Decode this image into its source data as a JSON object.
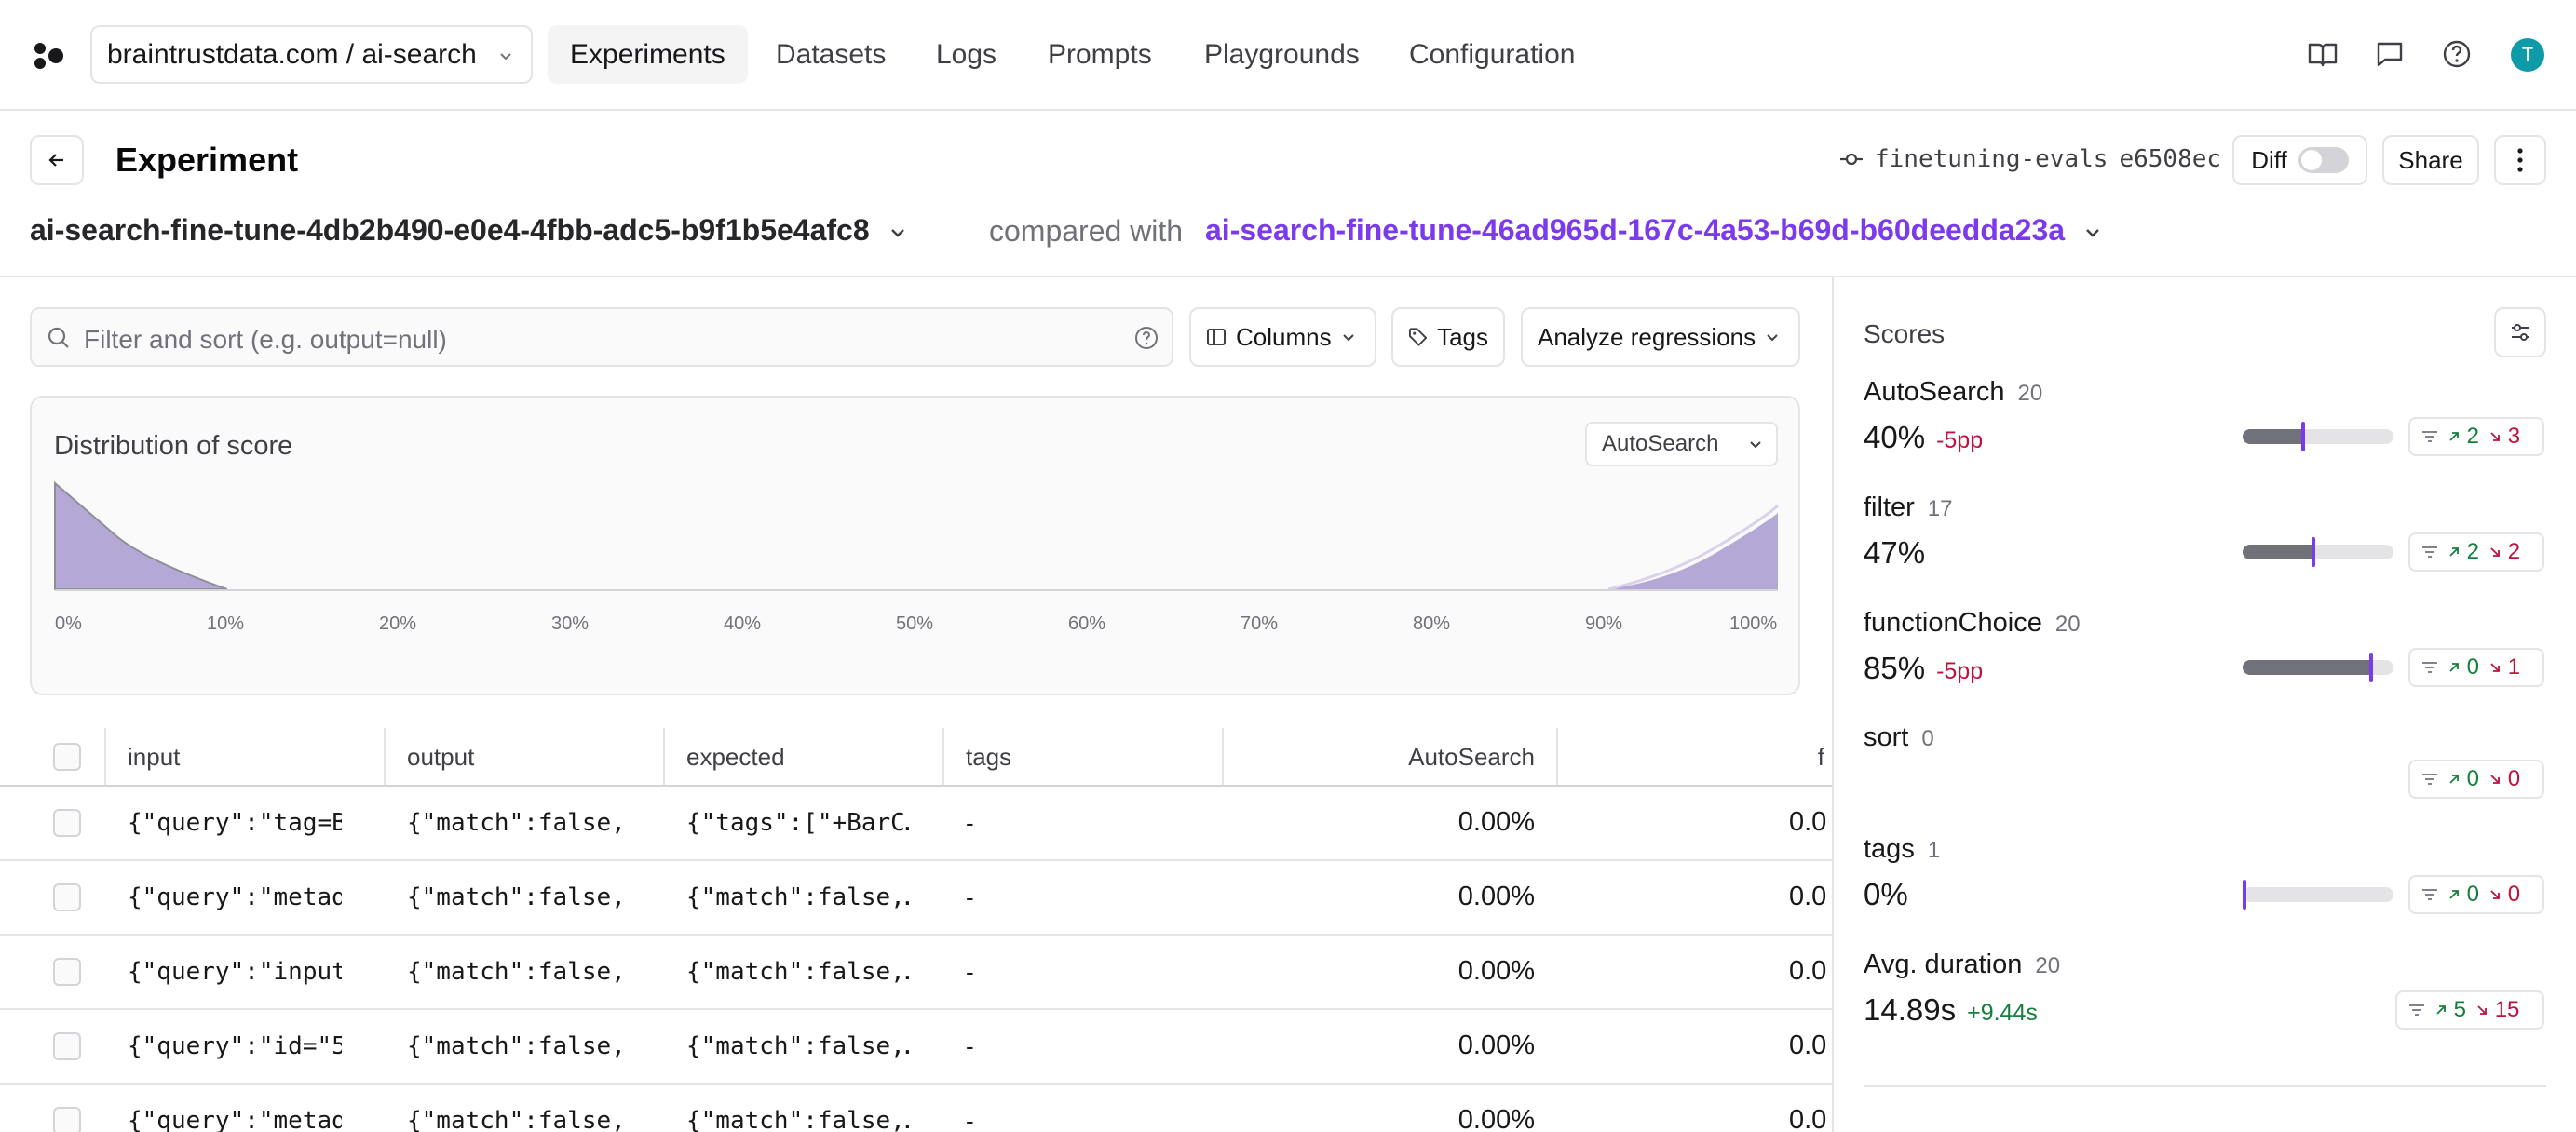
{
  "nav": {
    "project": "braintrustdata.com / ai-search",
    "tabs": [
      {
        "label": "Experiments",
        "active": true
      },
      {
        "label": "Datasets"
      },
      {
        "label": "Logs"
      },
      {
        "label": "Prompts"
      },
      {
        "label": "Playgrounds"
      },
      {
        "label": "Configuration"
      }
    ],
    "icons": [
      "book-icon",
      "chat-icon",
      "help-icon"
    ],
    "avatar": "T"
  },
  "header": {
    "title": "Experiment",
    "branch": "finetuning-evals",
    "commit": "e6508ec",
    "diff_label": "Diff",
    "share_label": "Share",
    "experiment_name": "ai-search-fine-tune-4db2b490-e0e4-4fbb-adc5-b9f1b5e4afc8",
    "compared_with_label": "compared with",
    "compared_name": "ai-search-fine-tune-46ad965d-167c-4a53-b69d-b60deedda23a"
  },
  "filters": {
    "search_placeholder": "Filter and sort (e.g. output=null)",
    "columns_label": "Columns",
    "tags_label": "Tags",
    "analyze_label": "Analyze regressions"
  },
  "distribution": {
    "title": "Distribution of score",
    "selected_score": "AutoSearch",
    "ticks": [
      "0%",
      "10%",
      "20%",
      "30%",
      "40%",
      "50%",
      "60%",
      "70%",
      "80%",
      "90%",
      "100%"
    ]
  },
  "table": {
    "headers": {
      "input": "input",
      "output": "output",
      "expected": "expected",
      "tags": "tags",
      "autosearch": "AutoSearch",
      "next": "f"
    },
    "rows": [
      {
        "input": "{\"query\":\"tag=B…",
        "output": "{\"match\":false,…",
        "expected": "{\"tags\":[\"+BarC…",
        "tags": "-",
        "autosearch": "0.00%",
        "next": "0.0"
      },
      {
        "input": "{\"query\":\"metad…",
        "output": "{\"match\":false,…",
        "expected": "{\"match\":false,…",
        "tags": "-",
        "autosearch": "0.00%",
        "next": "0.0"
      },
      {
        "input": "{\"query\":\"input…",
        "output": "{\"match\":false,…",
        "expected": "{\"match\":false,…",
        "tags": "-",
        "autosearch": "0.00%",
        "next": "0.0"
      },
      {
        "input": "{\"query\":\"id=\"5…",
        "output": "{\"match\":false,…",
        "expected": "{\"match\":false,…",
        "tags": "-",
        "autosearch": "0.00%",
        "next": "0.0"
      },
      {
        "input": "{\"query\":\"metad…",
        "output": "{\"match\":false,…",
        "expected": "{\"match\":false,…",
        "tags": "-",
        "autosearch": "0.00%",
        "next": "0.0"
      }
    ]
  },
  "scores": {
    "title": "Scores",
    "items": [
      {
        "name": "AutoSearch",
        "count": "20",
        "value": "40%",
        "diff": "-5pp",
        "diff_dir": "down",
        "bar": 0.4,
        "has_bar": true,
        "up": "2",
        "down": "3"
      },
      {
        "name": "filter",
        "count": "17",
        "value": "47%",
        "diff": "",
        "diff_dir": "",
        "bar": 0.47,
        "has_bar": true,
        "up": "2",
        "down": "2"
      },
      {
        "name": "functionChoice",
        "count": "20",
        "value": "85%",
        "diff": "-5pp",
        "diff_dir": "down",
        "bar": 0.85,
        "has_bar": true,
        "up": "0",
        "down": "1"
      },
      {
        "name": "sort",
        "count": "0",
        "value": "",
        "diff": "",
        "diff_dir": "",
        "bar": 0,
        "has_bar": false,
        "up": "0",
        "down": "0"
      },
      {
        "name": "tags",
        "count": "1",
        "value": "0%",
        "diff": "",
        "diff_dir": "",
        "bar": 0,
        "has_bar": true,
        "up": "0",
        "down": "0"
      },
      {
        "name": "Avg. duration",
        "count": "20",
        "value": "14.89s",
        "diff": "+9.44s",
        "diff_dir": "up",
        "bar": 0,
        "has_bar": false,
        "up": "5",
        "down": "15"
      }
    ]
  },
  "colors": {
    "accent": "#7c3aed",
    "positive": "#15803d",
    "negative": "#be123c",
    "avatar": "#0e9aa7"
  }
}
